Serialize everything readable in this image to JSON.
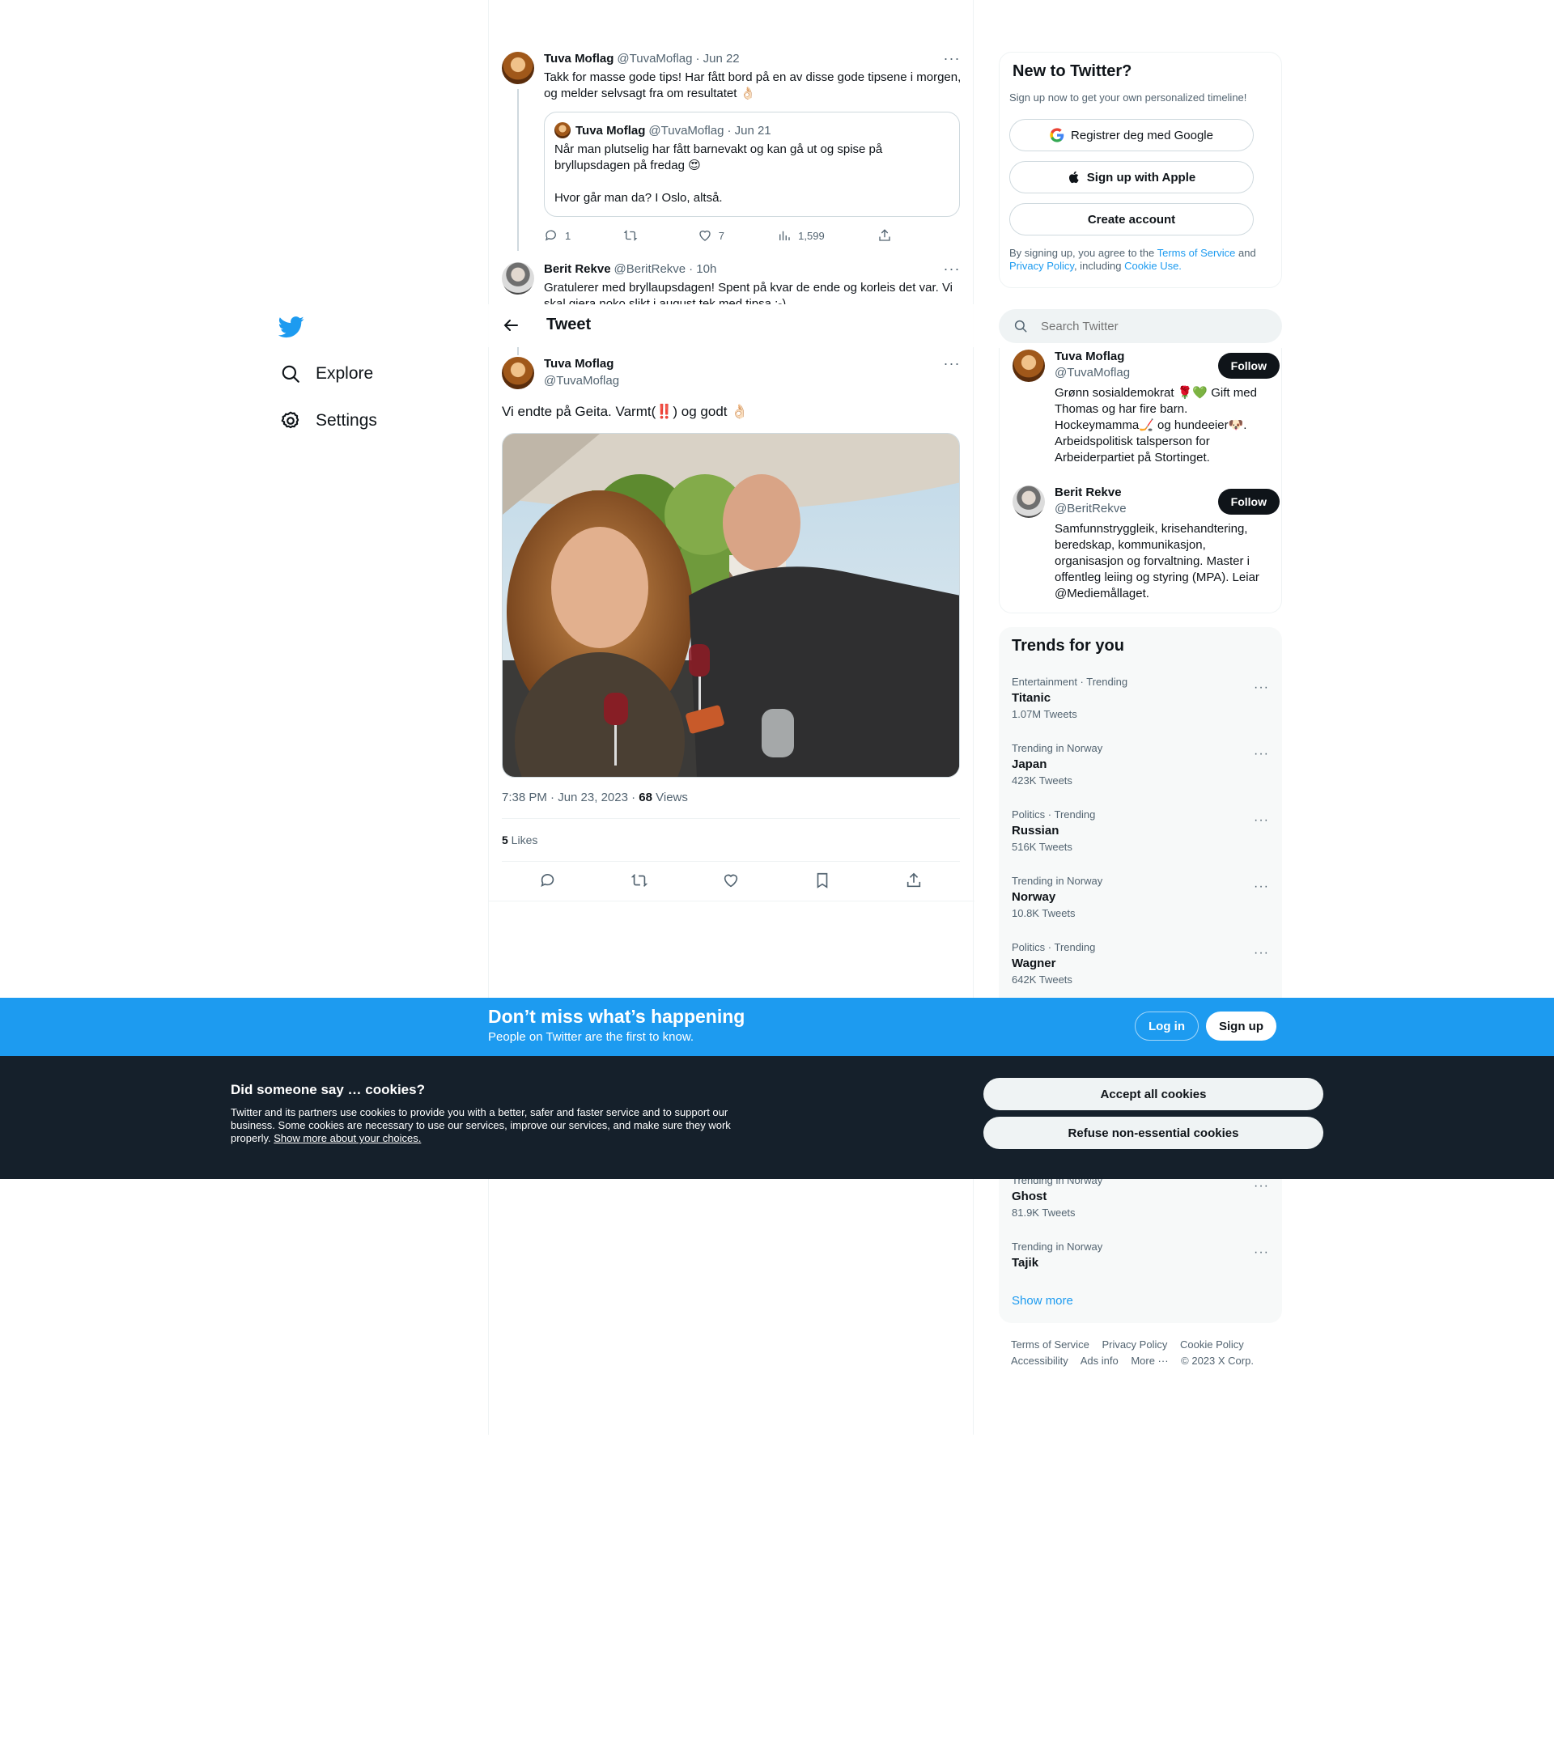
{
  "nav": {
    "items": [
      {
        "label": "Explore",
        "icon": "search-icon"
      },
      {
        "label": "Settings",
        "icon": "gear-icon"
      }
    ]
  },
  "thread": {
    "parent": {
      "name": "Tuva Moflag",
      "handle": "@TuvaMoflag",
      "date": "· Jun 22",
      "text": "Takk for masse gode tips! Har fått bord på en av disse gode tipsene i morgen, og melder selvsagt fra om resultatet 👌🏻",
      "quote": {
        "name": "Tuva Moflag",
        "handle": "@TuvaMoflag",
        "date": "· Jun 21",
        "text": "Når man plutselig har fått barnevakt og kan gå ut og spise på bryllupsdagen på fredag 😍\n\nHvor går man da? I Oslo, altså."
      },
      "replies": "1",
      "retweets": "",
      "likes": "7",
      "views": "1,599"
    },
    "reply": {
      "name": "Berit Rekve",
      "handle": "@BeritRekve",
      "date": "· 10h",
      "text": "Gratulerer med bryllaupsdagen! Spent på kvar de ende og korleis det var. Vi skal gjera noko slikt i august tek med tipsa ;-)"
    }
  },
  "header": {
    "title": "Tweet"
  },
  "main_tweet": {
    "name": "Tuva Moflag",
    "handle": "@TuvaMoflag",
    "text": "Vi endte på Geita. Varmt(‼️) og godt 👌🏻",
    "timestamp": "7:38 PM · Jun 23, 2023",
    "sep": " · ",
    "views_count": "68",
    "views_label": " Views",
    "likes_count": "5",
    "likes_label": " Likes"
  },
  "signup_card": {
    "title": "New to Twitter?",
    "subtitle": "Sign up now to get your own personalized timeline!",
    "google_label": "Registrer deg med Google",
    "apple_label": "Sign up with Apple",
    "create_label": "Create account",
    "legal_prefix": "By signing up, you agree to the ",
    "terms": "Terms of Service",
    "and": " and ",
    "privacy": "Privacy Policy",
    "including": ", including ",
    "cookie": "Cookie Use."
  },
  "search": {
    "placeholder": "Search Twitter"
  },
  "who_to_follow": [
    {
      "name": "Tuva Moflag",
      "handle": "@TuvaMoflag",
      "bio": "Grønn sosialdemokrat 🌹💚 Gift med Thomas og har fire barn. Hockeymamma🏒 og hundeeier🐶. Arbeidspolitisk talsperson for Arbeiderpartiet på Stortinget.",
      "button": "Follow"
    },
    {
      "name": "Berit Rekve",
      "handle": "@BeritRekve",
      "bio": "Samfunnstryggleik, krisehandtering, beredskap, kommunikasjon, organisasjon og forvaltning. Master i offentleg leiing og styring (MPA). Leiar @Mediemållaget.",
      "button": "Follow"
    }
  ],
  "trends": {
    "title": "Trends for you",
    "items": [
      {
        "context": "Entertainment · Trending",
        "name": "Titanic",
        "count": "1.07M Tweets"
      },
      {
        "context": "Trending in Norway",
        "name": "Japan",
        "count": "423K Tweets"
      },
      {
        "context": "Politics · Trending",
        "name": "Russian",
        "count": "516K Tweets"
      },
      {
        "context": "Trending in Norway",
        "name": "Norway",
        "count": "10.8K Tweets"
      },
      {
        "context": "Politics · Trending",
        "name": "Wagner",
        "count": "642K Tweets"
      },
      {
        "context": "Trending in Norway",
        "name": "Ghost",
        "count": "81.9K Tweets"
      },
      {
        "context": "Trending in Norway",
        "name": "Tajik",
        "count": ""
      }
    ],
    "show_more": "Show more"
  },
  "footer": {
    "links": [
      "Terms of Service",
      "Privacy Policy",
      "Cookie Policy",
      "Accessibility",
      "Ads info",
      "More ···"
    ],
    "copyright": "© 2023 X Corp."
  },
  "login_bar": {
    "title": "Don’t miss what’s happening",
    "subtitle": "People on Twitter are the first to know.",
    "login": "Log in",
    "signup": "Sign up"
  },
  "cookie_banner": {
    "title": "Did someone say … cookies?",
    "body": "Twitter and its partners use cookies to provide you with a better, safer and faster service and to support our business. Some cookies are necessary to use our services, improve our services, and make sure they work properly. ",
    "link": "Show more about your choices.",
    "accept": "Accept all cookies",
    "refuse": "Refuse non-essential cookies"
  },
  "colors": {
    "accent": "#1d9bf0",
    "text": "#0f1419",
    "muted": "#536471",
    "cookie_bg": "#15202b"
  }
}
